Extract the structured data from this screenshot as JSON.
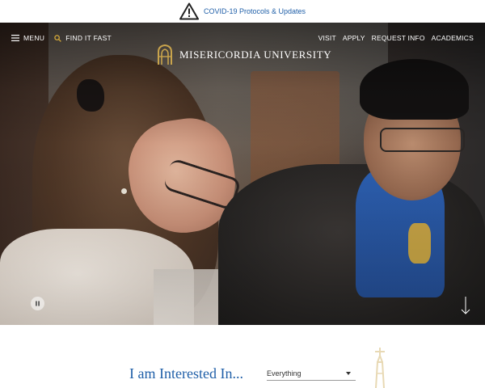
{
  "alert": {
    "text": "COVID-19 Protocols & Updates",
    "icon": "warning-triangle-icon"
  },
  "nav": {
    "menu_label": "MENU",
    "find_label": "FIND IT FAST",
    "links": [
      {
        "label": "VISIT"
      },
      {
        "label": "APPLY"
      },
      {
        "label": "REQUEST INFO"
      },
      {
        "label": "ACADEMICS"
      }
    ]
  },
  "logo": {
    "text": "MISERICORDIA UNIVERSITY",
    "icon": "gothic-arch-icon"
  },
  "hero": {
    "pause_icon": "pause-icon",
    "scroll_icon": "arrow-down-icon"
  },
  "interest": {
    "heading": "I am Interested In...",
    "selected": "Everything",
    "decor_icon": "tower-icon"
  },
  "colors": {
    "brand_blue": "#1f5fa8",
    "gold": "#c9a44c",
    "tower_tint": "#e8d9b4"
  }
}
